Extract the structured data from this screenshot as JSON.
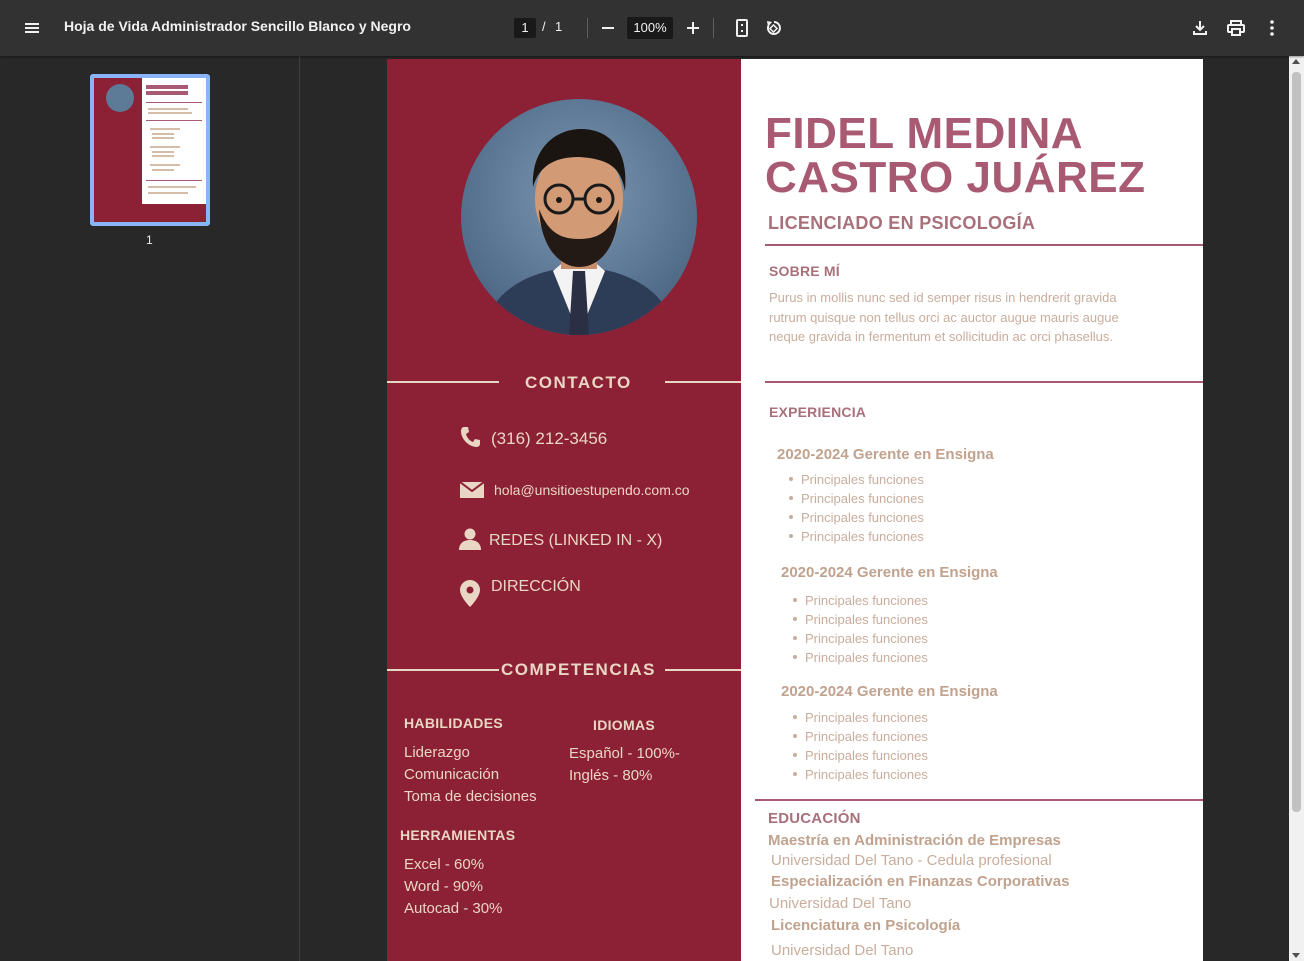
{
  "viewer": {
    "title": "Hoja de Vida Administrador Sencillo Blanco y Negro",
    "current_page": "1",
    "page_separator": "/",
    "total_pages": "1",
    "zoom": "100%",
    "thumbnail_label": "1"
  },
  "icons": {
    "menu": "menu-icon",
    "zoom_out": "minus-icon",
    "zoom_in": "plus-icon",
    "fit_page": "fit-page-icon",
    "rotate": "rotate-icon",
    "download": "download-icon",
    "print": "print-icon",
    "more": "more-vert-icon"
  },
  "colors": {
    "toolbar": "#323232",
    "viewer_bg": "#282828",
    "resume_left": "#8c2035",
    "accent_text": "#a85a72",
    "cream_text": "#ead6c4",
    "thumb_border": "#8ab4f8"
  },
  "resume": {
    "name_line1": "FIDEL MEDINA",
    "name_line2": "CASTRO JUÁREZ",
    "profession": "LICENCIADO EN PSICOLOGÍA",
    "contact": {
      "heading": "CONTACTO",
      "phone": "(316) 212-3456",
      "email": "hola@unsitioestupendo.com.co",
      "social": "REDES (LINKED IN - X)",
      "address": "DIRECCIÓN"
    },
    "competencias": {
      "heading": "COMPETENCIAS",
      "habilidades_heading": "HABILIDADES",
      "habilidades": [
        "Liderazgo",
        "Comunicación",
        "Toma de decisiones"
      ],
      "idiomas_heading": "IDIOMAS",
      "idiomas": [
        "Español - 100%-",
        "Inglés - 80%"
      ],
      "herramientas_heading": "HERRAMIENTAS",
      "herramientas": [
        "Excel - 60%",
        "Word - 90%",
        "Autocad - 30%"
      ]
    },
    "about": {
      "heading": "SOBRE MÍ",
      "text": "Purus in mollis nunc sed id semper risus in hendrerit gravida rutrum quisque non tellus orci ac auctor augue mauris augue neque gravida in fermentum et sollicitudin ac orci phasellus."
    },
    "experience": {
      "heading": "EXPERIENCIA",
      "jobs": [
        {
          "title": "2020-2024 Gerente en Ensigna",
          "items": [
            "Principales funciones",
            "Principales funciones",
            "Principales funciones",
            "Principales funciones"
          ]
        },
        {
          "title": "2020-2024 Gerente en Ensigna",
          "items": [
            "Principales funciones",
            "Principales funciones",
            "Principales funciones",
            "Principales funciones"
          ]
        },
        {
          "title": "2020-2024 Gerente en Ensigna",
          "items": [
            "Principales funciones",
            "Principales funciones",
            "Principales funciones",
            "Principales funciones"
          ]
        }
      ]
    },
    "education": {
      "heading": "EDUCACIÓN",
      "entries": [
        {
          "degree": "Maestría en Administración de Empresas",
          "school": "Universidad Del Tano - Cedula profesional"
        },
        {
          "degree": "Especialización en Finanzas Corporativas",
          "school": "Universidad Del Tano"
        },
        {
          "degree": "Licenciatura en Psicología",
          "school": "Universidad Del Tano"
        }
      ]
    }
  }
}
